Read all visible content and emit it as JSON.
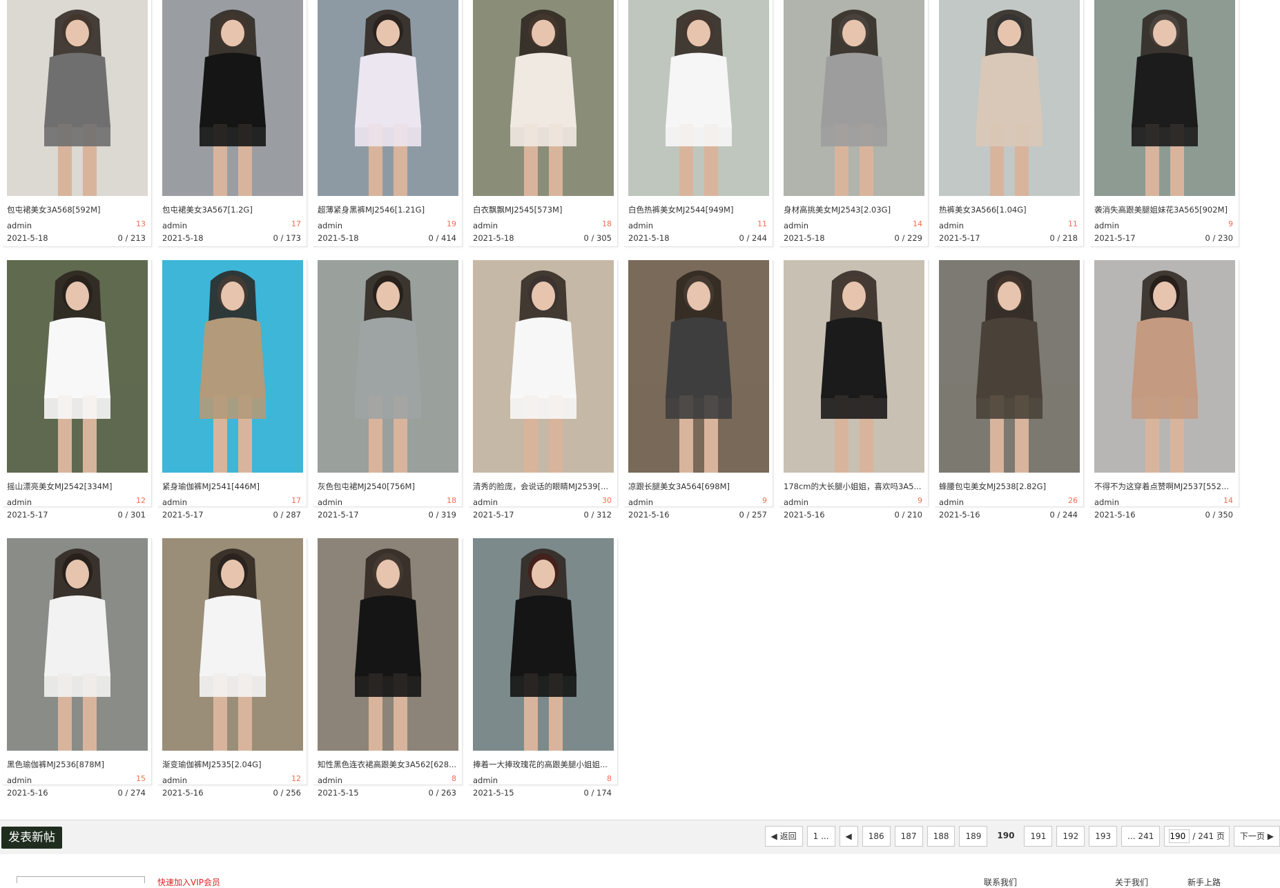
{
  "threads": [
    {
      "title": "包屯裙美女3A568[592M]",
      "author": "admin",
      "replies": "13",
      "date": "2021-5-18",
      "views": "0 / 213",
      "palette": [
        "#dcd8d2",
        "#6f6f6f",
        "#c9a88a"
      ]
    },
    {
      "title": "包屯裙美女3A567[1.2G]",
      "author": "admin",
      "replies": "17",
      "date": "2021-5-18",
      "views": "0 / 173",
      "palette": [
        "#9a9ea3",
        "#151515",
        "#c5a08a"
      ]
    },
    {
      "title": "超薄紧身黑裤MJ2546[1.21G]",
      "author": "admin",
      "replies": "19",
      "date": "2021-5-18",
      "views": "0 / 414",
      "palette": [
        "#8e9aa3",
        "#ece6f0",
        "#2d2d33"
      ]
    },
    {
      "title": "白衣飘飘MJ2545[573M]",
      "author": "admin",
      "replies": "18",
      "date": "2021-5-18",
      "views": "0 / 305",
      "palette": [
        "#8a8e78",
        "#efe9e2",
        "#cda98e"
      ]
    },
    {
      "title": "白色热裤美女MJ2544[949M]",
      "author": "admin",
      "replies": "11",
      "date": "2021-5-18",
      "views": "0 / 244",
      "palette": [
        "#bfc6bd",
        "#f6f6f6",
        "#d8b09a"
      ]
    },
    {
      "title": "身材高挑美女MJ2543[2.03G]",
      "author": "admin",
      "replies": "14",
      "date": "2021-5-18",
      "views": "0 / 229",
      "palette": [
        "#b0b4ac",
        "#9d9d9d",
        "#f2f2f2"
      ]
    },
    {
      "title": "热裤美女3A566[1.04G]",
      "author": "admin",
      "replies": "11",
      "date": "2021-5-17",
      "views": "0 / 218",
      "palette": [
        "#c2c8c6",
        "#d9c8b7",
        "#7a94b5"
      ]
    },
    {
      "title": "袭消失高跟美腿姐妹花3A565[902M]",
      "author": "admin",
      "replies": "9",
      "date": "2021-5-17",
      "views": "0 / 230",
      "palette": [
        "#8d9b93",
        "#1c1c1c",
        "#f4f4f4"
      ]
    },
    {
      "title": "摇山漂亮美女MJ2542[334M]",
      "author": "admin",
      "replies": "12",
      "date": "2021-5-17",
      "views": "0 / 301",
      "palette": [
        "#5f6a4f",
        "#f8f8f8",
        "#1c1c1c"
      ]
    },
    {
      "title": "紧身瑜伽裤MJ2541[446M]",
      "author": "admin",
      "replies": "17",
      "date": "2021-5-17",
      "views": "0 / 287",
      "palette": [
        "#3db6d8",
        "#b39a7a",
        "#c9c2b6"
      ]
    },
    {
      "title": "灰色包屯裙MJ2540[756M]",
      "author": "admin",
      "replies": "18",
      "date": "2021-5-17",
      "views": "0 / 319",
      "palette": [
        "#9aa09c",
        "#9ea3a4",
        "#1a1a1a"
      ]
    },
    {
      "title": "清秀的脸庞，会说话的眼睛MJ2539[...",
      "author": "admin",
      "replies": "30",
      "date": "2021-5-17",
      "views": "0 / 312",
      "palette": [
        "#c6b8a6",
        "#f7f7f7",
        "#a08aa6"
      ]
    },
    {
      "title": "凉跟长腿美女3A564[698M]",
      "author": "admin",
      "replies": "9",
      "date": "2021-5-16",
      "views": "0 / 257",
      "palette": [
        "#7a6a5a",
        "#3e3e3e",
        "#d8b8a0"
      ]
    },
    {
      "title": "178cm的大长腿小姐姐，喜欢吗3A5...",
      "author": "admin",
      "replies": "9",
      "date": "2021-5-16",
      "views": "0 / 210",
      "palette": [
        "#c8c0b2",
        "#1b1b1b",
        "#e2c4ae"
      ]
    },
    {
      "title": "蜂腰包屯美女MJ2538[2.82G]",
      "author": "admin",
      "replies": "26",
      "date": "2021-5-16",
      "views": "0 / 244",
      "palette": [
        "#7c7a72",
        "#4a4238",
        "#c89c80"
      ]
    },
    {
      "title": "不得不为这穿着点赞啊MJ2537[552...",
      "author": "admin",
      "replies": "14",
      "date": "2021-5-16",
      "views": "0 / 350",
      "palette": [
        "#b8b6b4",
        "#c49a80",
        "#15151c"
      ]
    },
    {
      "title": "黑色瑜伽裤MJ2536[878M]",
      "author": "admin",
      "replies": "15",
      "date": "2021-5-16",
      "views": "0 / 274",
      "palette": [
        "#8a8c88",
        "#f2f2f2",
        "#151515"
      ]
    },
    {
      "title": "渐变瑜伽裤MJ2535[2.04G]",
      "author": "admin",
      "replies": "12",
      "date": "2021-5-16",
      "views": "0 / 256",
      "palette": [
        "#9a8e78",
        "#f4f4f4",
        "#2a2a2a"
      ]
    },
    {
      "title": "知性黑色连衣裙高跟美女3A562[628...",
      "author": "admin",
      "replies": "8",
      "date": "2021-5-15",
      "views": "0 / 263",
      "palette": [
        "#8c8478",
        "#151515",
        "#d8b8a0"
      ]
    },
    {
      "title": "捧着一大捧玫瑰花的高跟美腿小姐姐...",
      "author": "admin",
      "replies": "8",
      "date": "2021-5-15",
      "views": "0 / 174",
      "palette": [
        "#7d8a8c",
        "#151515",
        "#d41c1c"
      ]
    }
  ],
  "toolbar": {
    "post_label": "发表新帖"
  },
  "pagination": {
    "back_label": "返回",
    "first_label": "1 ...",
    "prev_label": "",
    "pages": [
      "186",
      "187",
      "188",
      "189",
      "190",
      "191",
      "192",
      "193"
    ],
    "current": "190",
    "last_label": "... 241",
    "jump_value": "190",
    "jump_suffix": "/ 241 页",
    "next_label": "下一页"
  },
  "footer": {
    "partial_left": "快速加入VIP会员",
    "partial_mid": "联系我们",
    "partial_right1": "关于我们",
    "partial_right2": "新手上路"
  },
  "colors": {
    "replies": "#f26c4f",
    "post_button": "#1f2d1f",
    "bar_bg": "#f2f2f2"
  }
}
